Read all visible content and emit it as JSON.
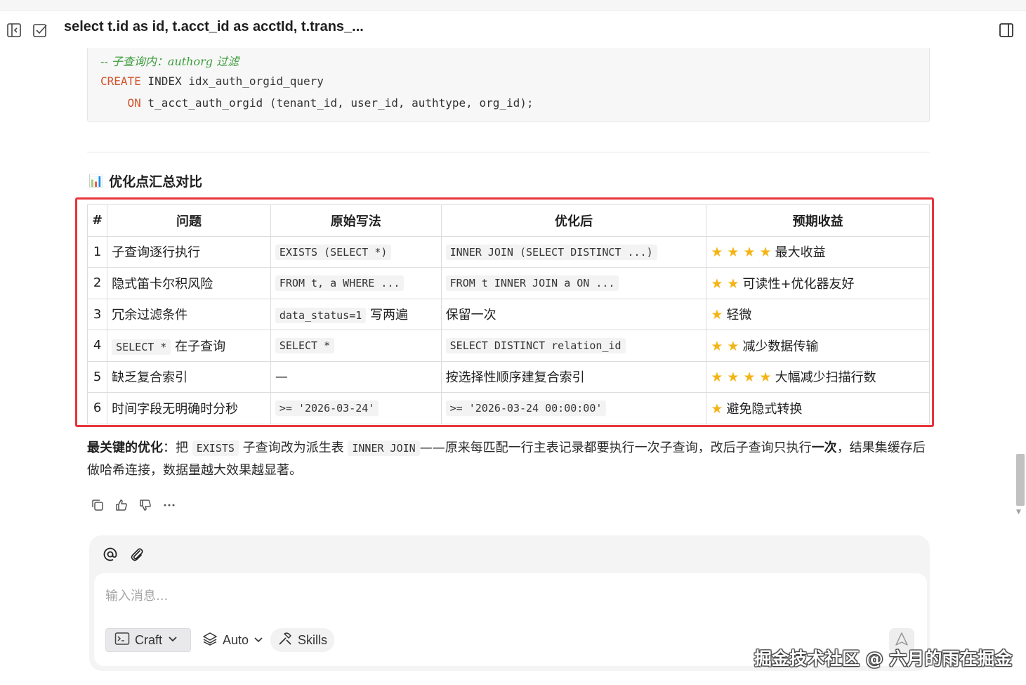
{
  "header": {
    "title": "select t.id as id, t.acct_id as acctId, t.trans_..."
  },
  "code_block": {
    "comment": "-- 子查询内：authorg 过滤",
    "line2_kw": "CREATE",
    "line2_rest": " INDEX idx_auth_orgid_query",
    "line3_indent": "    ",
    "line3_kw": "ON",
    "line3_rest": " t_acct_auth_orgid (tenant_id, user_id, authtype, org_id);"
  },
  "section": {
    "emoji": "📊",
    "title": "优化点汇总对比"
  },
  "table": {
    "headers": [
      "#",
      "问题",
      "原始写法",
      "优化后",
      "预期收益"
    ],
    "rows": [
      {
        "num": "1",
        "problem": "子查询逐行执行",
        "original": "EXISTS (SELECT *)",
        "optimized": "INNER JOIN (SELECT DISTINCT ...)",
        "stars": "★ ★ ★ ★",
        "benefit": "最大收益"
      },
      {
        "num": "2",
        "problem": "隐式笛卡尔积风险",
        "original": "FROM t, a WHERE ...",
        "optimized": "FROM t INNER JOIN a ON ...",
        "stars": "★ ★",
        "benefit": "可读性+优化器友好"
      },
      {
        "num": "3",
        "problem": "冗余过滤条件",
        "original": "data_status=1",
        "original_suffix": "写两遍",
        "optimized_text": "保留一次",
        "stars": "★",
        "benefit": "轻微"
      },
      {
        "num": "4",
        "problem_code": "SELECT *",
        "problem_suffix": "在子查询",
        "original": "SELECT *",
        "optimized": "SELECT DISTINCT relation_id",
        "stars": "★ ★",
        "benefit": "减少数据传输"
      },
      {
        "num": "5",
        "problem": "缺乏复合索引",
        "original_text": "—",
        "optimized_text": "按选择性顺序建复合索引",
        "stars": "★ ★ ★ ★",
        "benefit": "大幅减少扫描行数"
      },
      {
        "num": "6",
        "problem": "时间字段无明确时分秒",
        "original": ">= '2026-03-24'",
        "optimized": ">= '2026-03-24 00:00:00'",
        "stars": "★",
        "benefit": "避免隐式转换"
      }
    ]
  },
  "paragraph": {
    "lead_bold": "最关键的优化",
    "colon": "：把 ",
    "code1": "EXISTS",
    "mid1": " 子查询改为派生表 ",
    "code2": "INNER JOIN",
    "mid2": "——原来每匹配一行主表记录都要执行一次子查询，改后子查询只执行",
    "bold2": "一次",
    "tail": "，结果集缓存后做哈希连接，数据量越大效果越显著。"
  },
  "input": {
    "placeholder": "输入消息...",
    "craft_label": "Craft",
    "auto_label": "Auto",
    "skills_label": "Skills"
  },
  "watermark": "掘金技术社区 @ 六月的雨在掘金",
  "colors": {
    "highlight_frame": "#e8343c",
    "star": "#f5b416",
    "keyword": "#d2552d",
    "comment": "#3c9d3a"
  }
}
